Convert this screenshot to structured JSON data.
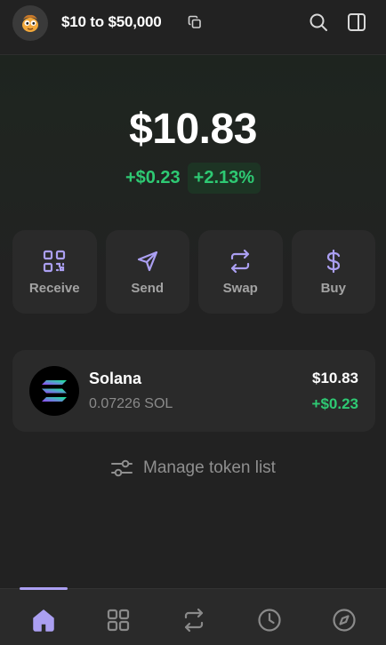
{
  "header": {
    "account_name": "$10 to $50,000",
    "avatar_icon": "ghost-mascot-icon",
    "copy_icon": "copy-icon",
    "search_icon": "search-icon",
    "sidebar_icon": "sidebar-panel-icon"
  },
  "portfolio": {
    "balance": "$10.83",
    "change_amount": "+$0.23",
    "change_percent": "+2.13%"
  },
  "actions": [
    {
      "label": "Receive",
      "icon": "qr-code-icon"
    },
    {
      "label": "Send",
      "icon": "send-arrow-icon"
    },
    {
      "label": "Swap",
      "icon": "swap-arrows-icon"
    },
    {
      "label": "Buy",
      "icon": "dollar-icon"
    }
  ],
  "tokens": [
    {
      "name": "Solana",
      "balance": "0.07226 SOL",
      "value": "$10.83",
      "change": "+$0.23",
      "logo": "solana-logo-icon"
    }
  ],
  "manage": {
    "label": "Manage token list",
    "icon": "sliders-icon"
  },
  "nav": {
    "items": [
      {
        "name": "home",
        "icon": "home-icon",
        "active": true
      },
      {
        "name": "collectibles",
        "icon": "grid-icon",
        "active": false
      },
      {
        "name": "swap",
        "icon": "swap-icon",
        "active": false
      },
      {
        "name": "activity",
        "icon": "clock-icon",
        "active": false
      },
      {
        "name": "explore",
        "icon": "compass-icon",
        "active": false
      }
    ]
  },
  "colors": {
    "accent": "#ab9ff2",
    "positive": "#2ec973",
    "card": "#2a2a2a",
    "background": "#222222"
  }
}
